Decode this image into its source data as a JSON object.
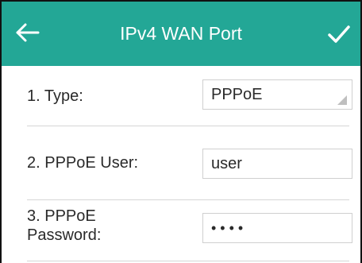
{
  "header": {
    "title": "IPv4 WAN Port",
    "back_icon": "arrow-left-icon",
    "confirm_icon": "checkmark-icon",
    "color": "#23a796"
  },
  "fields": [
    {
      "label": "1. Type:",
      "value": "PPPoE",
      "control": "select"
    },
    {
      "label": "2. PPPoE User:",
      "value": "user",
      "control": "text"
    },
    {
      "label_line1": "3. PPPoE",
      "label_line2": "Password:",
      "value": "••••",
      "control": "password"
    }
  ]
}
